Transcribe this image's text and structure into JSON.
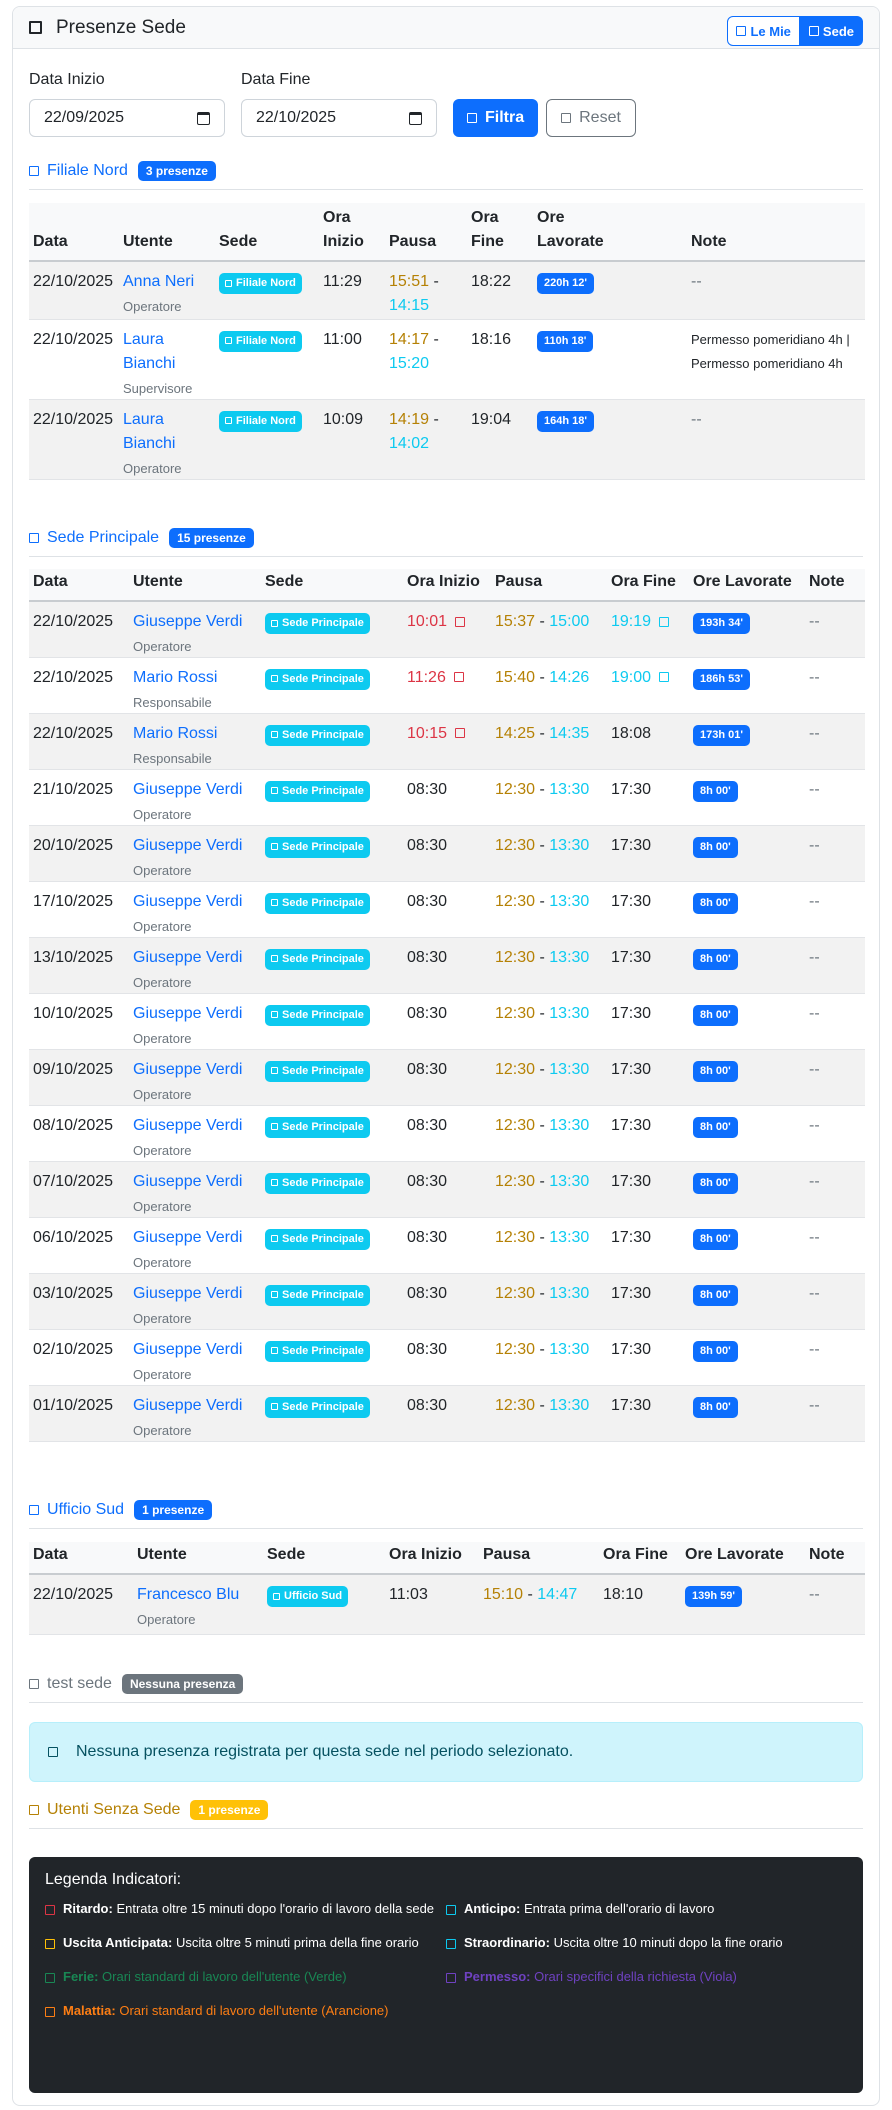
{
  "header": {
    "title": "Presenze Sede",
    "btn_mie": "Le Mie",
    "btn_sede": "Sede"
  },
  "filters": {
    "start_label": "Data Inizio",
    "start_value": "22/09/2025",
    "end_label": "Data Fine",
    "end_value": "22/10/2025",
    "filter_btn": "Filtra",
    "reset_btn": "Reset"
  },
  "colors": {
    "primary": "#0d6efd",
    "info": "#0dcaf0",
    "danger": "#dc3545",
    "warning_text": "#b58105"
  },
  "filiale_nord": {
    "title": "Filiale Nord",
    "badge": "3 presenze",
    "headers": [
      "Data",
      "Utente",
      "Sede",
      "Ora Inizio",
      "Pausa",
      "Ora Fine",
      "Ore Lavorate",
      "Note"
    ],
    "rows": [
      {
        "date": "22/10/2025",
        "user": "Anna Neri",
        "role": "Operatore",
        "sede": "Filiale Nord",
        "start": "11:29",
        "p_start": "15:51",
        "p_end": "14:15",
        "end": "18:22",
        "hours": "220h 12'",
        "note": "--"
      },
      {
        "date": "22/10/2025",
        "user": "Laura Bianchi",
        "role": "Supervisore",
        "sede": "Filiale Nord",
        "start": "11:00",
        "p_start": "14:17",
        "p_end": "15:20",
        "end": "18:16",
        "hours": "110h 18'",
        "note": "Permesso pomeridiano 4h | Permesso pomeridiano 4h"
      },
      {
        "date": "22/10/2025",
        "user": "Laura Bianchi",
        "role": "Operatore",
        "sede": "Filiale Nord",
        "start": "10:09",
        "p_start": "14:19",
        "p_end": "14:02",
        "end": "19:04",
        "hours": "164h 18'",
        "note": "--"
      }
    ]
  },
  "sede_principale": {
    "title": "Sede Principale",
    "badge": "15 presenze",
    "headers": [
      "Data",
      "Utente",
      "Sede",
      "Ora Inizio",
      "Pausa",
      "Ora Fine",
      "Ore Lavorate",
      "Note"
    ],
    "rows": [
      {
        "date": "22/10/2025",
        "user": "Giuseppe Verdi",
        "role": "Operatore",
        "sede": "Sede Principale",
        "start": "10:01",
        "start_late": true,
        "p_start": "15:37",
        "p_end": "15:00",
        "end": "19:19",
        "end_over": true,
        "hours": "193h 34'",
        "note": "--"
      },
      {
        "date": "22/10/2025",
        "user": "Mario Rossi",
        "role": "Responsabile",
        "sede": "Sede Principale",
        "start": "11:26",
        "start_late": true,
        "p_start": "15:40",
        "p_end": "14:26",
        "end": "19:00",
        "end_over": true,
        "hours": "186h 53'",
        "note": "--"
      },
      {
        "date": "22/10/2025",
        "user": "Mario Rossi",
        "role": "Responsabile",
        "sede": "Sede Principale",
        "start": "10:15",
        "start_late": true,
        "p_start": "14:25",
        "p_end": "14:35",
        "end": "18:08",
        "end_over": false,
        "hours": "173h 01'",
        "note": "--"
      },
      {
        "date": "21/10/2025",
        "user": "Giuseppe Verdi",
        "role": "Operatore",
        "sede": "Sede Principale",
        "start": "08:30",
        "start_late": false,
        "p_start": "12:30",
        "p_end": "13:30",
        "end": "17:30",
        "end_over": false,
        "hours": "8h 00'",
        "note": "--"
      },
      {
        "date": "20/10/2025",
        "user": "Giuseppe Verdi",
        "role": "Operatore",
        "sede": "Sede Principale",
        "start": "08:30",
        "start_late": false,
        "p_start": "12:30",
        "p_end": "13:30",
        "end": "17:30",
        "end_over": false,
        "hours": "8h 00'",
        "note": "--"
      },
      {
        "date": "17/10/2025",
        "user": "Giuseppe Verdi",
        "role": "Operatore",
        "sede": "Sede Principale",
        "start": "08:30",
        "start_late": false,
        "p_start": "12:30",
        "p_end": "13:30",
        "end": "17:30",
        "end_over": false,
        "hours": "8h 00'",
        "note": "--"
      },
      {
        "date": "13/10/2025",
        "user": "Giuseppe Verdi",
        "role": "Operatore",
        "sede": "Sede Principale",
        "start": "08:30",
        "start_late": false,
        "p_start": "12:30",
        "p_end": "13:30",
        "end": "17:30",
        "end_over": false,
        "hours": "8h 00'",
        "note": "--"
      },
      {
        "date": "10/10/2025",
        "user": "Giuseppe Verdi",
        "role": "Operatore",
        "sede": "Sede Principale",
        "start": "08:30",
        "start_late": false,
        "p_start": "12:30",
        "p_end": "13:30",
        "end": "17:30",
        "end_over": false,
        "hours": "8h 00'",
        "note": "--"
      },
      {
        "date": "09/10/2025",
        "user": "Giuseppe Verdi",
        "role": "Operatore",
        "sede": "Sede Principale",
        "start": "08:30",
        "start_late": false,
        "p_start": "12:30",
        "p_end": "13:30",
        "end": "17:30",
        "end_over": false,
        "hours": "8h 00'",
        "note": "--"
      },
      {
        "date": "08/10/2025",
        "user": "Giuseppe Verdi",
        "role": "Operatore",
        "sede": "Sede Principale",
        "start": "08:30",
        "start_late": false,
        "p_start": "12:30",
        "p_end": "13:30",
        "end": "17:30",
        "end_over": false,
        "hours": "8h 00'",
        "note": "--"
      },
      {
        "date": "07/10/2025",
        "user": "Giuseppe Verdi",
        "role": "Operatore",
        "sede": "Sede Principale",
        "start": "08:30",
        "start_late": false,
        "p_start": "12:30",
        "p_end": "13:30",
        "end": "17:30",
        "end_over": false,
        "hours": "8h 00'",
        "note": "--"
      },
      {
        "date": "06/10/2025",
        "user": "Giuseppe Verdi",
        "role": "Operatore",
        "sede": "Sede Principale",
        "start": "08:30",
        "start_late": false,
        "p_start": "12:30",
        "p_end": "13:30",
        "end": "17:30",
        "end_over": false,
        "hours": "8h 00'",
        "note": "--"
      },
      {
        "date": "03/10/2025",
        "user": "Giuseppe Verdi",
        "role": "Operatore",
        "sede": "Sede Principale",
        "start": "08:30",
        "start_late": false,
        "p_start": "12:30",
        "p_end": "13:30",
        "end": "17:30",
        "end_over": false,
        "hours": "8h 00'",
        "note": "--"
      },
      {
        "date": "02/10/2025",
        "user": "Giuseppe Verdi",
        "role": "Operatore",
        "sede": "Sede Principale",
        "start": "08:30",
        "start_late": false,
        "p_start": "12:30",
        "p_end": "13:30",
        "end": "17:30",
        "end_over": false,
        "hours": "8h 00'",
        "note": "--"
      },
      {
        "date": "01/10/2025",
        "user": "Giuseppe Verdi",
        "role": "Operatore",
        "sede": "Sede Principale",
        "start": "08:30",
        "start_late": false,
        "p_start": "12:30",
        "p_end": "13:30",
        "end": "17:30",
        "end_over": false,
        "hours": "8h 00'",
        "note": "--"
      }
    ]
  },
  "ufficio_sud": {
    "title": "Ufficio Sud",
    "badge": "1 presenze",
    "headers": [
      "Data",
      "Utente",
      "Sede",
      "Ora Inizio",
      "Pausa",
      "Ora Fine",
      "Ore Lavorate",
      "Note"
    ],
    "rows": [
      {
        "date": "22/10/2025",
        "user": "Francesco Blu",
        "role": "Operatore",
        "sede": "Ufficio Sud",
        "start": "11:03",
        "p_start": "15:10",
        "p_end": "14:47",
        "end": "18:10",
        "hours": "139h 59'",
        "note": "--"
      }
    ]
  },
  "test_sede": {
    "title": "test sede",
    "badge": "Nessuna presenza",
    "alert": "Nessuna presenza registrata per questa sede nel periodo selezionato."
  },
  "senza_sede": {
    "title": "Utenti Senza Sede",
    "badge": "1 presenze"
  },
  "legend": {
    "title": "Legenda Indicatori:",
    "items": [
      {
        "label": "Ritardo:",
        "text": "Entrata oltre 15 minuti dopo l'orario di lavoro della sede",
        "color": "#dc3545"
      },
      {
        "label": "Anticipo:",
        "text": "Entrata prima dell'orario di lavoro",
        "color": "#0dcaf0"
      },
      {
        "label": "Uscita Anticipata:",
        "text": "Uscita oltre 5 minuti prima della fine orario",
        "color": "#ffc107"
      },
      {
        "label": "Straordinario:",
        "text": "Uscita oltre 10 minuti dopo la fine orario",
        "color": "#0dcaf0"
      },
      {
        "label": "Ferie:",
        "text": "Orari standard di lavoro dell'utente (Verde)",
        "color": "#198754"
      },
      {
        "label": "Permesso:",
        "text": "Orari specifici della richiesta (Viola)",
        "color": "#6f42c1"
      },
      {
        "label": "Malattia:",
        "text": "Orari standard di lavoro dell'utente (Arancione)",
        "color": "#fd7e14"
      }
    ]
  }
}
